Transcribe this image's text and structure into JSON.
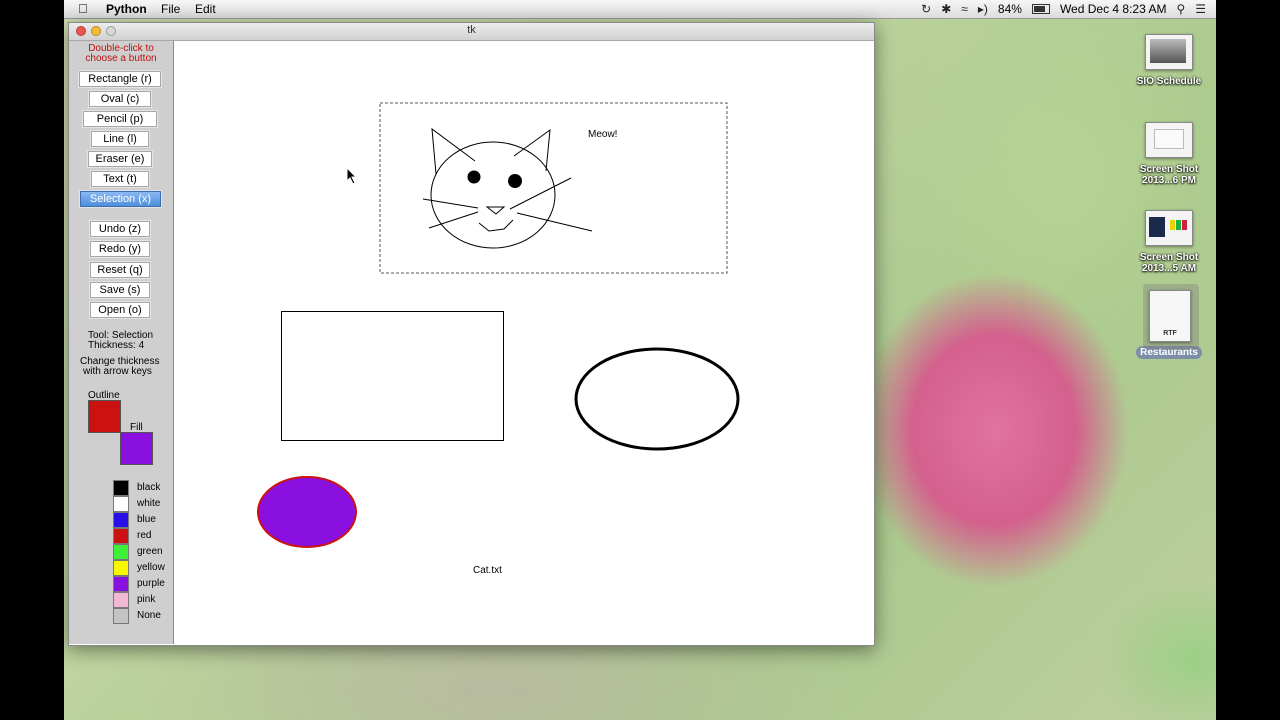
{
  "menubar": {
    "app_name": "Python",
    "menus": [
      "File",
      "Edit"
    ],
    "battery": "84%",
    "datetime": "Wed Dec 4  8:23 AM"
  },
  "window": {
    "title": "tk"
  },
  "panel": {
    "hint_line1": "Double-click to",
    "hint_line2": "choose a button",
    "tool_buttons": [
      {
        "label": "Rectangle (r)"
      },
      {
        "label": "Oval (c)"
      },
      {
        "label": "Pencil (p)"
      },
      {
        "label": "Line (l)"
      },
      {
        "label": "Eraser (e)"
      },
      {
        "label": "Text (t)"
      },
      {
        "label": "Selection (x)",
        "active": true
      }
    ],
    "action_buttons": [
      {
        "label": "Undo (z)"
      },
      {
        "label": "Redo (y)"
      },
      {
        "label": "Reset (q)"
      },
      {
        "label": "Save (s)"
      },
      {
        "label": "Open (o)"
      }
    ],
    "tool_status": "Tool: Selection",
    "thickness_status": "Thickness: 4",
    "thickness_hint1": "Change thickness",
    "thickness_hint2": "with arrow keys",
    "outline_label": "Outline",
    "fill_label": "Fill",
    "outline_color": "#cc1111",
    "fill_color": "#8a10e0",
    "palette": [
      {
        "name": "black",
        "color": "#000000"
      },
      {
        "name": "white",
        "color": "#ffffff"
      },
      {
        "name": "blue",
        "color": "#2a10e8"
      },
      {
        "name": "red",
        "color": "#cc1111"
      },
      {
        "name": "green",
        "color": "#3ef03a"
      },
      {
        "name": "yellow",
        "color": "#f8f800"
      },
      {
        "name": "purple",
        "color": "#8a10e0"
      },
      {
        "name": "pink",
        "color": "#f2b8d4"
      },
      {
        "name": "None",
        "color": "#c4c4c4"
      }
    ]
  },
  "canvas": {
    "meow_text": "Meow!",
    "file_text": "Cat.txt"
  },
  "desktop": {
    "icons": [
      {
        "label1": "SIO Schedule",
        "label2": ""
      },
      {
        "label1": "Screen Shot",
        "label2": "2013...6 PM"
      },
      {
        "label1": "Screen Shot",
        "label2": "2013...5 AM"
      },
      {
        "label1": "RTF",
        "label2": "Restaurants"
      }
    ]
  }
}
